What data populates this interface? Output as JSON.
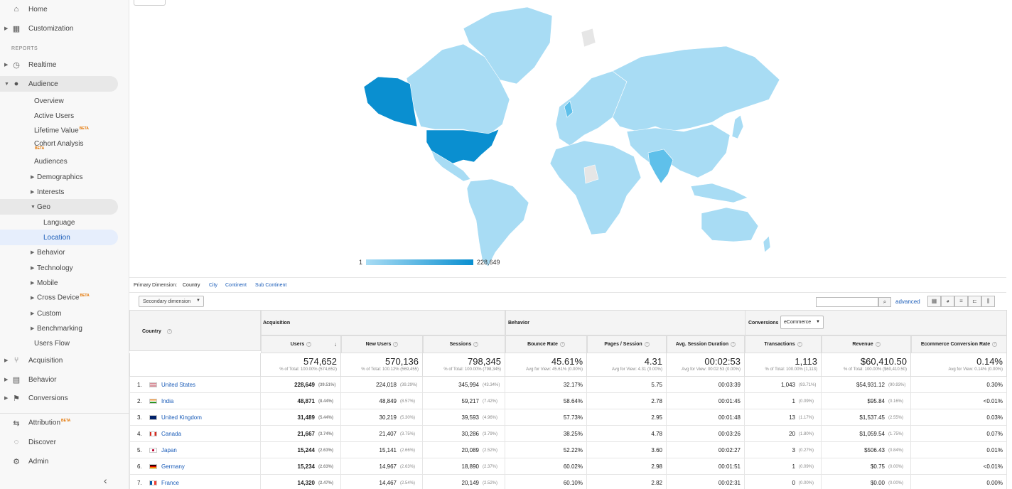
{
  "sidebar": {
    "home": "Home",
    "customization": "Customization",
    "reports_label": "REPORTS",
    "realtime": "Realtime",
    "audience": "Audience",
    "audience_items": {
      "overview": "Overview",
      "active_users": "Active Users",
      "lifetime_value": "Lifetime Value",
      "cohort_analysis": "Cohort Analysis",
      "audiences": "Audiences",
      "demographics": "Demographics",
      "interests": "Interests",
      "geo": "Geo",
      "language": "Language",
      "location": "Location",
      "behavior": "Behavior",
      "technology": "Technology",
      "mobile": "Mobile",
      "cross_device": "Cross Device",
      "custom": "Custom",
      "benchmarking": "Benchmarking",
      "users_flow": "Users Flow"
    },
    "acquisition": "Acquisition",
    "behavior": "Behavior",
    "conversions": "Conversions",
    "attribution": "Attribution",
    "discover": "Discover",
    "admin": "Admin",
    "beta": "BETA"
  },
  "map": {
    "legend_min": "1",
    "legend_max": "228,649",
    "colors": {
      "low": "#a8dcf4",
      "mid": "#5fc0ea",
      "high": "#0a8fd0",
      "none": "#e6e6e6"
    }
  },
  "dimension": {
    "label": "Primary Dimension:",
    "options": [
      "Country",
      "City",
      "Continent",
      "Sub Continent"
    ],
    "selected": "Country",
    "secondary": "Secondary dimension",
    "advanced": "advanced"
  },
  "table": {
    "country_header": "Country",
    "groups": {
      "acquisition": "Acquisition",
      "behavior": "Behavior",
      "conversions": "Conversions"
    },
    "conversions_select": "eCommerce",
    "columns": [
      "Users",
      "New Users",
      "Sessions",
      "Bounce Rate",
      "Pages / Session",
      "Avg. Session Duration",
      "Transactions",
      "Revenue",
      "Ecommerce Conversion Rate"
    ],
    "totals": [
      {
        "value": "574,652",
        "sub": "% of Total: 100.00% (574,652)"
      },
      {
        "value": "570,136",
        "sub": "% of Total: 100.12% (569,455)"
      },
      {
        "value": "798,345",
        "sub": "% of Total: 100.00% (798,345)"
      },
      {
        "value": "45.61%",
        "sub": "Avg for View: 45.61% (0.00%)"
      },
      {
        "value": "4.31",
        "sub": "Avg for View: 4.31 (0.00%)"
      },
      {
        "value": "00:02:53",
        "sub": "Avg for View: 00:02:53 (0.00%)"
      },
      {
        "value": "1,113",
        "sub": "% of Total: 100.00% (1,113)"
      },
      {
        "value": "$60,410.50",
        "sub": "% of Total: 100.00% ($60,410.50)"
      },
      {
        "value": "0.14%",
        "sub": "Avg for View: 0.14% (0.00%)"
      }
    ],
    "rows": [
      {
        "rank": "1.",
        "country": "United States",
        "flag": "us",
        "users": "228,649",
        "users_pct": "(39.51%)",
        "new_users": "224,018",
        "new_users_pct": "(39.29%)",
        "sessions": "345,994",
        "sessions_pct": "(43.34%)",
        "bounce": "32.17%",
        "pages": "5.75",
        "duration": "00:03:39",
        "transactions": "1,043",
        "transactions_pct": "(93.71%)",
        "revenue": "$54,931.12",
        "revenue_pct": "(90.93%)",
        "conv": "0.30%"
      },
      {
        "rank": "2.",
        "country": "India",
        "flag": "in",
        "users": "48,871",
        "users_pct": "(8.44%)",
        "new_users": "48,849",
        "new_users_pct": "(8.57%)",
        "sessions": "59,217",
        "sessions_pct": "(7.42%)",
        "bounce": "58.64%",
        "pages": "2.78",
        "duration": "00:01:45",
        "transactions": "1",
        "transactions_pct": "(0.09%)",
        "revenue": "$95.84",
        "revenue_pct": "(0.16%)",
        "conv": "<0.01%"
      },
      {
        "rank": "3.",
        "country": "United Kingdom",
        "flag": "gb",
        "users": "31,489",
        "users_pct": "(5.44%)",
        "new_users": "30,219",
        "new_users_pct": "(5.30%)",
        "sessions": "39,593",
        "sessions_pct": "(4.96%)",
        "bounce": "57.73%",
        "pages": "2.95",
        "duration": "00:01:48",
        "transactions": "13",
        "transactions_pct": "(1.17%)",
        "revenue": "$1,537.45",
        "revenue_pct": "(2.55%)",
        "conv": "0.03%"
      },
      {
        "rank": "4.",
        "country": "Canada",
        "flag": "ca",
        "users": "21,667",
        "users_pct": "(3.74%)",
        "new_users": "21,407",
        "new_users_pct": "(3.75%)",
        "sessions": "30,286",
        "sessions_pct": "(3.79%)",
        "bounce": "38.25%",
        "pages": "4.78",
        "duration": "00:03:26",
        "transactions": "20",
        "transactions_pct": "(1.80%)",
        "revenue": "$1,059.54",
        "revenue_pct": "(1.75%)",
        "conv": "0.07%"
      },
      {
        "rank": "5.",
        "country": "Japan",
        "flag": "jp",
        "users": "15,244",
        "users_pct": "(2.63%)",
        "new_users": "15,141",
        "new_users_pct": "(2.66%)",
        "sessions": "20,089",
        "sessions_pct": "(2.52%)",
        "bounce": "52.22%",
        "pages": "3.60",
        "duration": "00:02:27",
        "transactions": "3",
        "transactions_pct": "(0.27%)",
        "revenue": "$506.43",
        "revenue_pct": "(0.84%)",
        "conv": "0.01%"
      },
      {
        "rank": "6.",
        "country": "Germany",
        "flag": "de",
        "users": "15,234",
        "users_pct": "(2.63%)",
        "new_users": "14,967",
        "new_users_pct": "(2.63%)",
        "sessions": "18,890",
        "sessions_pct": "(2.37%)",
        "bounce": "60.02%",
        "pages": "2.98",
        "duration": "00:01:51",
        "transactions": "1",
        "transactions_pct": "(0.09%)",
        "revenue": "$0.75",
        "revenue_pct": "(0.00%)",
        "conv": "<0.01%"
      },
      {
        "rank": "7.",
        "country": "France",
        "flag": "fr",
        "users": "14,320",
        "users_pct": "(2.47%)",
        "new_users": "14,467",
        "new_users_pct": "(2.54%)",
        "sessions": "20,149",
        "sessions_pct": "(2.52%)",
        "bounce": "60.10%",
        "pages": "2.82",
        "duration": "00:02:31",
        "transactions": "0",
        "transactions_pct": "(0.00%)",
        "revenue": "$0.00",
        "revenue_pct": "(0.00%)",
        "conv": "0.00%"
      }
    ]
  }
}
